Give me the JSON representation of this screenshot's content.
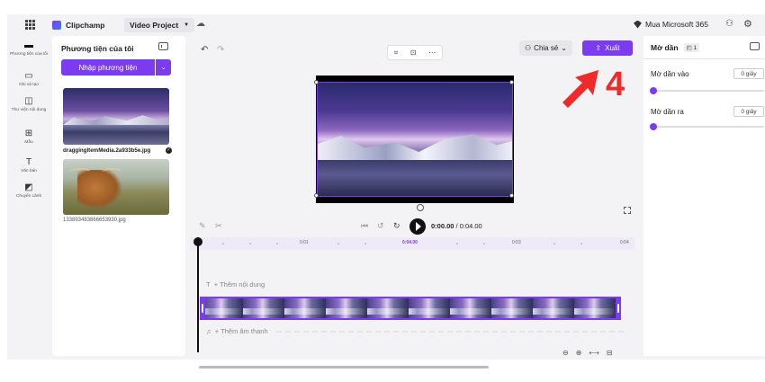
{
  "topbar": {
    "brand": "Clipchamp",
    "project": "Video Project",
    "ms365": "Mua Microsoft 365"
  },
  "leftnav": [
    {
      "label": "Phương tiện của tôi",
      "icon": "folder-icon"
    },
    {
      "label": "Ghi và tạo",
      "icon": "camera-icon"
    },
    {
      "label": "Thư viện nội dung",
      "icon": "library-icon"
    },
    {
      "label": "Mẫu",
      "icon": "templates-icon"
    },
    {
      "label": "Văn bản",
      "icon": "text-icon"
    },
    {
      "label": "Chuyển cảnh",
      "icon": "transitions-icon"
    }
  ],
  "media": {
    "title": "Phương tiện của tôi",
    "import_label": "Nhập phương tiện",
    "items": [
      {
        "caption": "draggingItemMedia.2a933b5e.jpg"
      },
      {
        "caption": "133893483866653930.jpg"
      }
    ]
  },
  "preview": {
    "share_label": "Chia sẻ",
    "export_label": "Xuất",
    "annotation_number": "4"
  },
  "playback": {
    "current_time": "0:00.00",
    "total_time": "/ 0:04.00"
  },
  "timeline": {
    "ticks": [
      "0:01",
      "0:04.00",
      "0:03",
      "0:04"
    ],
    "add_text_label": "+ Thêm nội dung",
    "add_audio_label": "+ Thêm âm thanh"
  },
  "props": {
    "title": "Mờ dần",
    "badge": "1",
    "fade_in_label": "Mờ dần vào",
    "fade_in_value": "0 giây",
    "fade_out_label": "Mờ dần ra",
    "fade_out_value": "0 giây"
  },
  "colors": {
    "accent": "#7b3cf0",
    "annotation": "#ee2a2a"
  }
}
